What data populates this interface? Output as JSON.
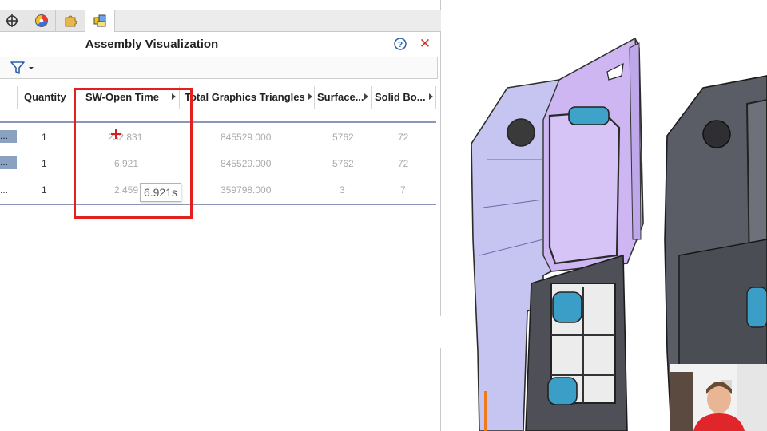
{
  "panel": {
    "title": "Assembly Visualization",
    "tabs": [
      {
        "icon": "crosshair-icon"
      },
      {
        "icon": "appearance-icon"
      },
      {
        "icon": "puzzle-icon"
      },
      {
        "icon": "assembly-visualization-icon",
        "active": true
      }
    ],
    "help_icon": "help-icon",
    "close_icon": "close-icon",
    "close_glyph": "✕",
    "filter_icon": "filter-icon"
  },
  "table": {
    "headers": [
      "Quantity",
      "SW-Open Time",
      "Total Graphics Triangles",
      "Surface...",
      "Solid Bo..."
    ],
    "rows": [
      {
        "name": "...",
        "quantity": "1",
        "open_time": "232.831",
        "triangles": "845529.000",
        "surfaces": "5762",
        "solid_bodies": "72"
      },
      {
        "name": "...",
        "quantity": "1",
        "open_time": "6.921",
        "triangles": "845529.000",
        "surfaces": "5762",
        "solid_bodies": "72"
      },
      {
        "name": "...",
        "quantity": "1",
        "open_time": "2.459",
        "triangles": "359798.000",
        "surfaces": "3",
        "solid_bodies": "7"
      }
    ]
  },
  "tooltip": {
    "text": "6.921s"
  },
  "colors": {
    "highlight_box": "#e2201e",
    "row_selection": "#8aa1c1",
    "part_purple": "#c9b4f2",
    "part_gray": "#5b5d66"
  }
}
